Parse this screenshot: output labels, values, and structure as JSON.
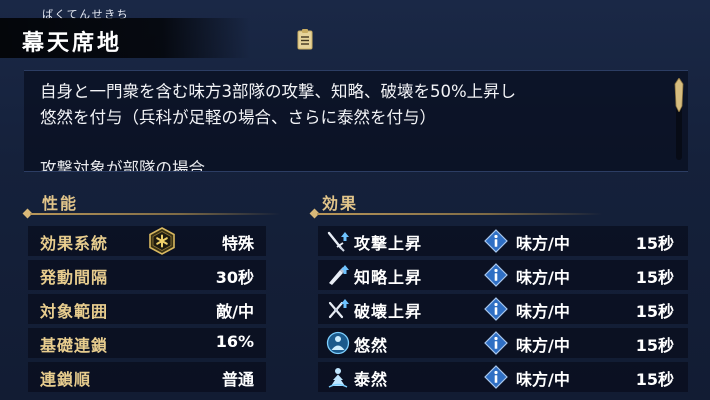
{
  "header": {
    "ruby": "ばくてんせきち",
    "title": "幕天席地",
    "doc_icon": "document-icon"
  },
  "description": {
    "line1": "自身と一門衆を含む味方3部隊の攻撃、知略、破壊を50%上昇し",
    "line2": "悠然を付与（兵科が足軽の場合、さらに泰然を付与）",
    "line3": "攻撃対象が部隊の場合"
  },
  "performance": {
    "heading": "性能",
    "rows": [
      {
        "label": "効果系統",
        "value": "特殊",
        "icon": "special-hexagon-icon"
      },
      {
        "label": "発動間隔",
        "value": "30秒"
      },
      {
        "label": "対象範囲",
        "value": "敵/中"
      },
      {
        "label": "基礎連鎖",
        "value": "16%"
      },
      {
        "label": "連鎖順",
        "value": "普通"
      }
    ]
  },
  "effects": {
    "heading": "効果",
    "rows": [
      {
        "name": "攻撃上昇",
        "target": "味方/中",
        "duration": "15秒",
        "icon": "attack-up-icon"
      },
      {
        "name": "知略上昇",
        "target": "味方/中",
        "duration": "15秒",
        "icon": "intellect-up-icon"
      },
      {
        "name": "破壊上昇",
        "target": "味方/中",
        "duration": "15秒",
        "icon": "destruction-up-icon"
      },
      {
        "name": "悠然",
        "target": "味方/中",
        "duration": "15秒",
        "icon": "yuuzen-icon"
      },
      {
        "name": "泰然",
        "target": "味方/中",
        "duration": "15秒",
        "icon": "taizen-icon"
      }
    ]
  },
  "colors": {
    "gold_label": "#e8cd8e",
    "section_gold": "#e2c58a",
    "panel_bg": "#0a1020",
    "info_blue": "#3f7fd0"
  }
}
